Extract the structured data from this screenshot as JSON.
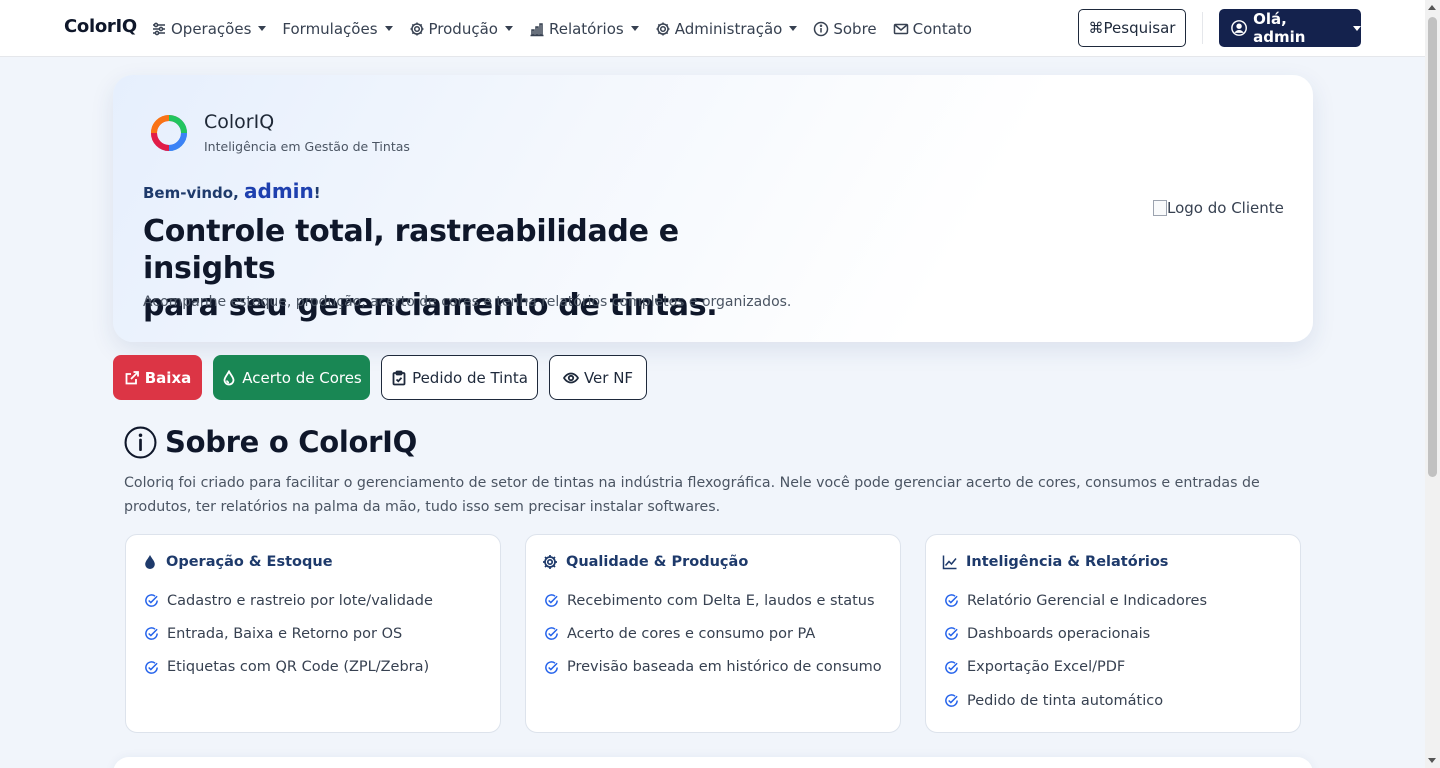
{
  "navbar": {
    "brand": "ColorIQ",
    "items": [
      {
        "label": "Operações",
        "icon": "sliders-icon",
        "dropdown": true
      },
      {
        "label": "Formulações",
        "icon": "",
        "dropdown": true
      },
      {
        "label": "Produção",
        "icon": "gear-icon",
        "dropdown": true
      },
      {
        "label": "Relatórios",
        "icon": "bar-chart-icon",
        "dropdown": true
      },
      {
        "label": "Administração",
        "icon": "gear-icon",
        "dropdown": true
      },
      {
        "label": "Sobre",
        "icon": "info-icon",
        "dropdown": false
      },
      {
        "label": "Contato",
        "icon": "envelope-icon",
        "dropdown": false
      }
    ],
    "search_label": "⌘Pesquisar",
    "user_label": "Olá, admin"
  },
  "hero": {
    "brand": "ColorIQ",
    "tagline": "Inteligência em Gestão de Tintas",
    "welcome_prefix": "Bem-vindo, ",
    "username": "admin",
    "welcome_suffix": "!",
    "title_line1": "Controle total, rastreabilidade e insights",
    "title_line2": "para seu gerenciamento de tintas.",
    "description": "Acompanhe estoque, produção, acerto de cores e tenha relatórios completos e organizados.",
    "client_logo_alt": "Logo do Cliente"
  },
  "actions": {
    "baixa": "Baixa",
    "acerto": "Acerto de Cores",
    "pedido": "Pedido de Tinta",
    "nf": "Ver NF"
  },
  "about": {
    "title": "Sobre o ColorIQ",
    "description": "Coloriq foi criado para facilitar o gerenciamento de setor de tintas na indústria flexográfica. Nele você pode gerenciar acerto de cores, consumos e entradas de produtos, ter relatórios na palma da mão, tudo isso sem precisar instalar softwares.",
    "cards": [
      {
        "title": "Operação & Estoque",
        "icon": "droplet-icon",
        "items": [
          "Cadastro e rastreio por lote/validade",
          "Entrada, Baixa e Retorno por OS",
          "Etiquetas com QR Code (ZPL/Zebra)"
        ]
      },
      {
        "title": "Qualidade & Produção",
        "icon": "gear-icon",
        "items": [
          "Recebimento com Delta E, laudos e status",
          "Acerto de cores e consumo por PA",
          "Previsão baseada em histórico de consumo"
        ]
      },
      {
        "title": "Inteligência & Relatórios",
        "icon": "trend-chart-icon",
        "items": [
          "Relatório Gerencial e Indicadores",
          "Dashboards operacionais",
          "Exportação Excel/PDF",
          "Pedido de tinta automático"
        ]
      }
    ]
  },
  "colors": {
    "primary_dark": "#14224d",
    "danger": "#dc3545",
    "success": "#198754",
    "check": "#2563eb"
  }
}
